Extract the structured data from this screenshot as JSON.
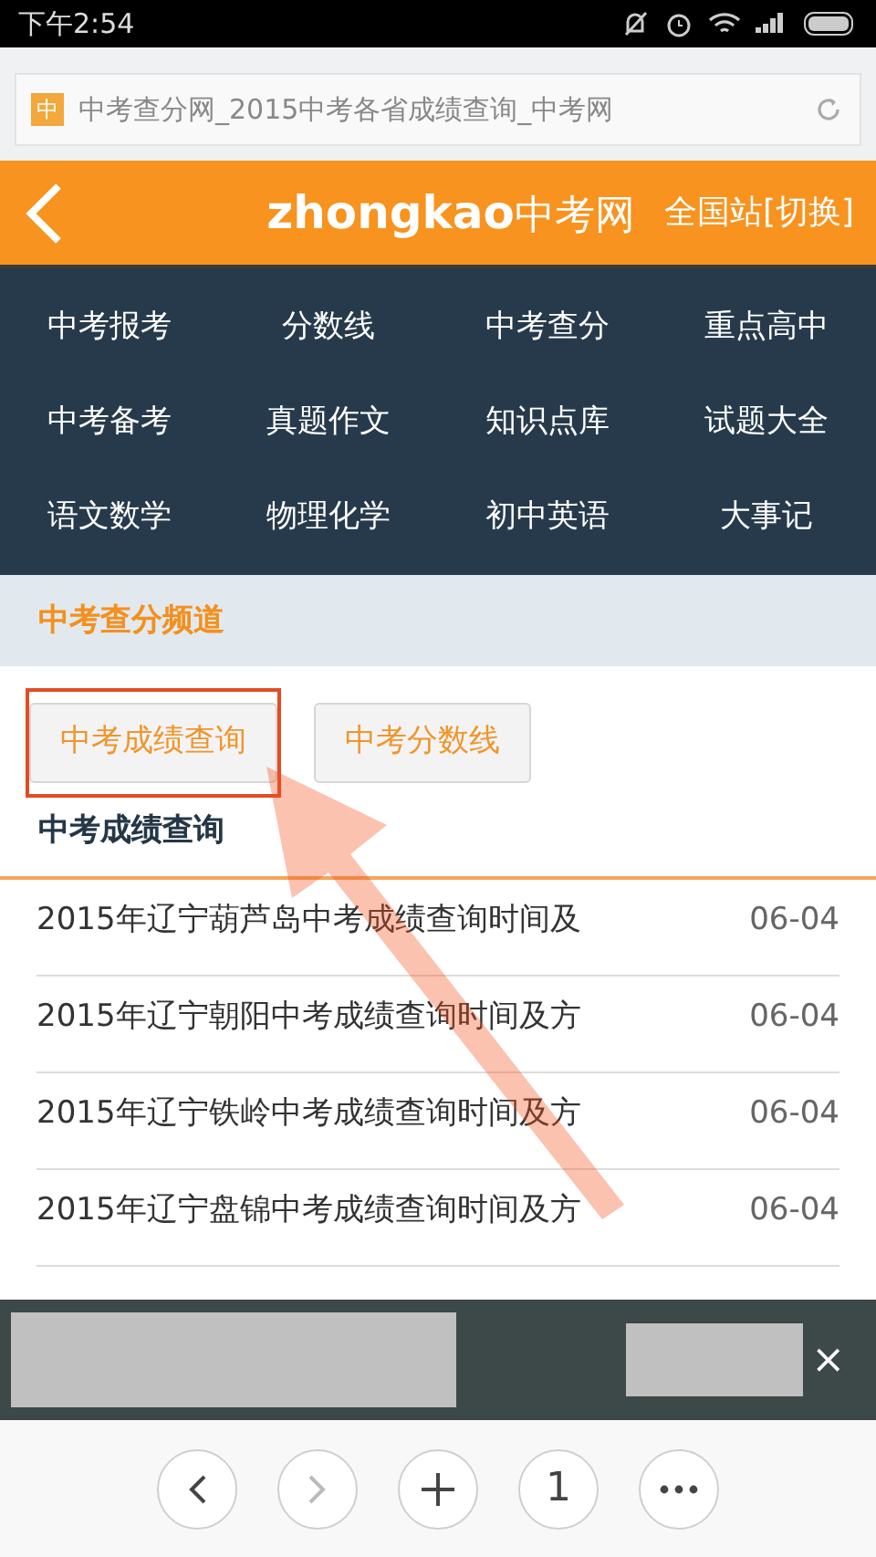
{
  "status_bar": {
    "time": "下午2:54"
  },
  "address_bar": {
    "site_icon": "中",
    "title": "中考查分网_2015中考各省成绩查询_中考网"
  },
  "header": {
    "logo_latin": "zhongkao",
    "logo_cjk": "中考网",
    "station": "全国站[切换]"
  },
  "nav": [
    {
      "label": "中考报考"
    },
    {
      "label": "分数线"
    },
    {
      "label": "中考查分"
    },
    {
      "label": "重点高中"
    },
    {
      "label": "中考备考"
    },
    {
      "label": "真题作文"
    },
    {
      "label": "知识点库"
    },
    {
      "label": "试题大全"
    },
    {
      "label": "语文数学"
    },
    {
      "label": "物理化学"
    },
    {
      "label": "初中英语"
    },
    {
      "label": "大事记"
    }
  ],
  "channel": {
    "title": "中考查分频道"
  },
  "channel_buttons": [
    {
      "label": "中考成绩查询",
      "highlighted": true
    },
    {
      "label": "中考分数线",
      "highlighted": false
    }
  ],
  "section": {
    "title": "中考成绩查询"
  },
  "articles": [
    {
      "title": "2015年辽宁葫芦岛中考成绩查询时间及",
      "date": "06-04"
    },
    {
      "title": "2015年辽宁朝阳中考成绩查询时间及方",
      "date": "06-04"
    },
    {
      "title": "2015年辽宁铁岭中考成绩查询时间及方",
      "date": "06-04"
    },
    {
      "title": "2015年辽宁盘锦中考成绩查询时间及方",
      "date": "06-04"
    }
  ],
  "ad_bar": {
    "close": "×"
  },
  "toolbar": {
    "tab_count": "1"
  }
}
